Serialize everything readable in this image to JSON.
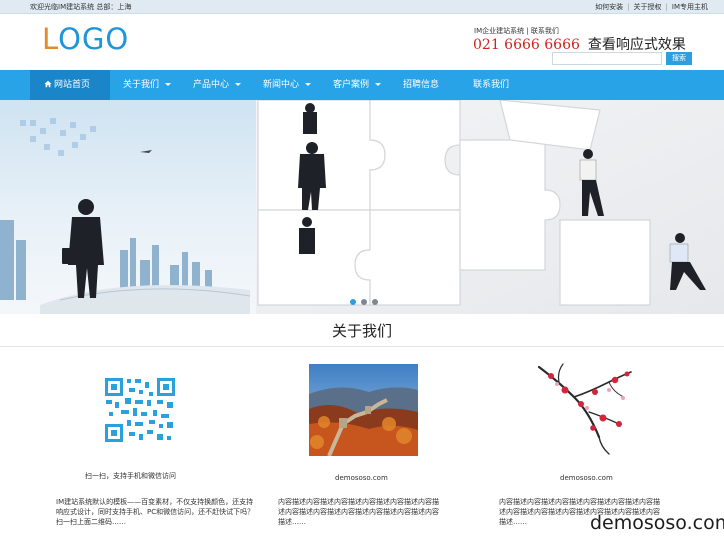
{
  "topbar": {
    "welcome": "欢迎光临IM建站系统 总部：上海",
    "links": [
      "如何安装",
      "关于授权",
      "IM专用主机"
    ]
  },
  "header": {
    "logo_part1": "L",
    "logo_part2": "OGO",
    "line1": "IM企业建站系统  |  联系我们",
    "phone": "021 6666 6666",
    "effect": "查看响应式效果",
    "search_placeholder": "",
    "search_button": "搜索"
  },
  "nav": {
    "items": [
      {
        "label": "网站首页"
      },
      {
        "label": "关于我们"
      },
      {
        "label": "产品中心"
      },
      {
        "label": "新闻中心"
      },
      {
        "label": "客户案例"
      },
      {
        "label": "招聘信息"
      },
      {
        "label": "联系我们"
      }
    ]
  },
  "section": {
    "title": "关于我们",
    "items": [
      {
        "caption": "扫一扫，支持手机和微信访问",
        "desc": "IM建站系统默认的模板——百变素材，不仅支持换颜色，还支持响应式设计，同时支持手机、PC和微信访问，还不赶快试下吗？扫一扫上面二维码……"
      },
      {
        "caption": "demososo.com",
        "desc": "内容描述内容描述内容描述内容描述内容描述内容描述内容描述内容描述内容描述内容描述内容描述内容描述……"
      },
      {
        "caption": "demososo.com",
        "desc": "内容描述内容描述内容描述内容描述内容描述内容描述内容描述内容描述内容描述内容描述内容描述内容描述……"
      }
    ]
  },
  "watermark": "demososo.com",
  "colors": {
    "nav": "#29a3e8",
    "nav_active": "#1a86c9",
    "phone": "#d0241c",
    "logo_orange": "#e58a2c",
    "logo_blue": "#1d95d8"
  }
}
